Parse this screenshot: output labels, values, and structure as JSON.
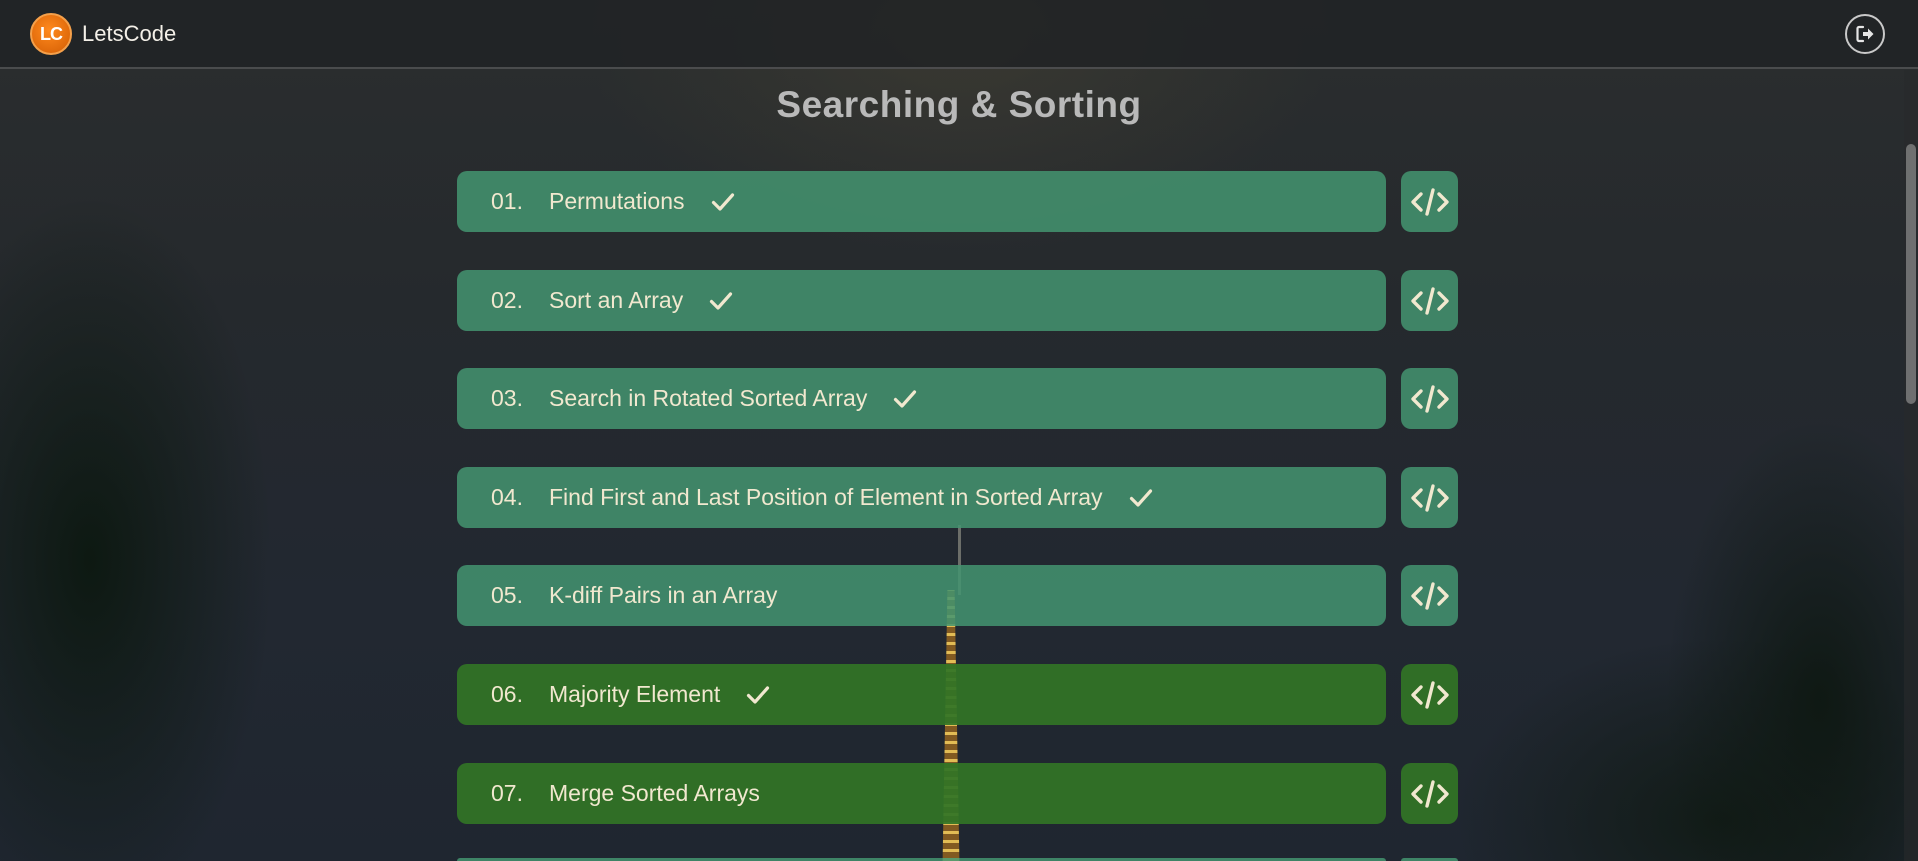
{
  "navbar": {
    "brand_logo_text": "LC",
    "brand_name": "LetsCode",
    "logout_icon": "logout-icon"
  },
  "page": {
    "title": "Searching & Sorting"
  },
  "colors": {
    "teal_row": "#439470",
    "green_row": "#317426",
    "text": "#f1e8cf",
    "logo": "#e06a0b"
  },
  "problems": [
    {
      "number": "01.",
      "title": "Permutations",
      "solved": true,
      "style": "teal"
    },
    {
      "number": "02.",
      "title": "Sort an Array",
      "solved": true,
      "style": "teal"
    },
    {
      "number": "03.",
      "title": "Search in Rotated Sorted Array",
      "solved": true,
      "style": "teal"
    },
    {
      "number": "04.",
      "title": "Find First and Last Position of Element in Sorted Array",
      "solved": true,
      "style": "teal"
    },
    {
      "number": "05.",
      "title": "K-diff Pairs in an Array",
      "solved": false,
      "style": "teal"
    },
    {
      "number": "06.",
      "title": "Majority Element",
      "solved": true,
      "style": "green"
    },
    {
      "number": "07.",
      "title": "Merge Sorted Arrays",
      "solved": false,
      "style": "green"
    }
  ],
  "icons": {
    "solved": "check-icon",
    "code": "code-icon"
  }
}
